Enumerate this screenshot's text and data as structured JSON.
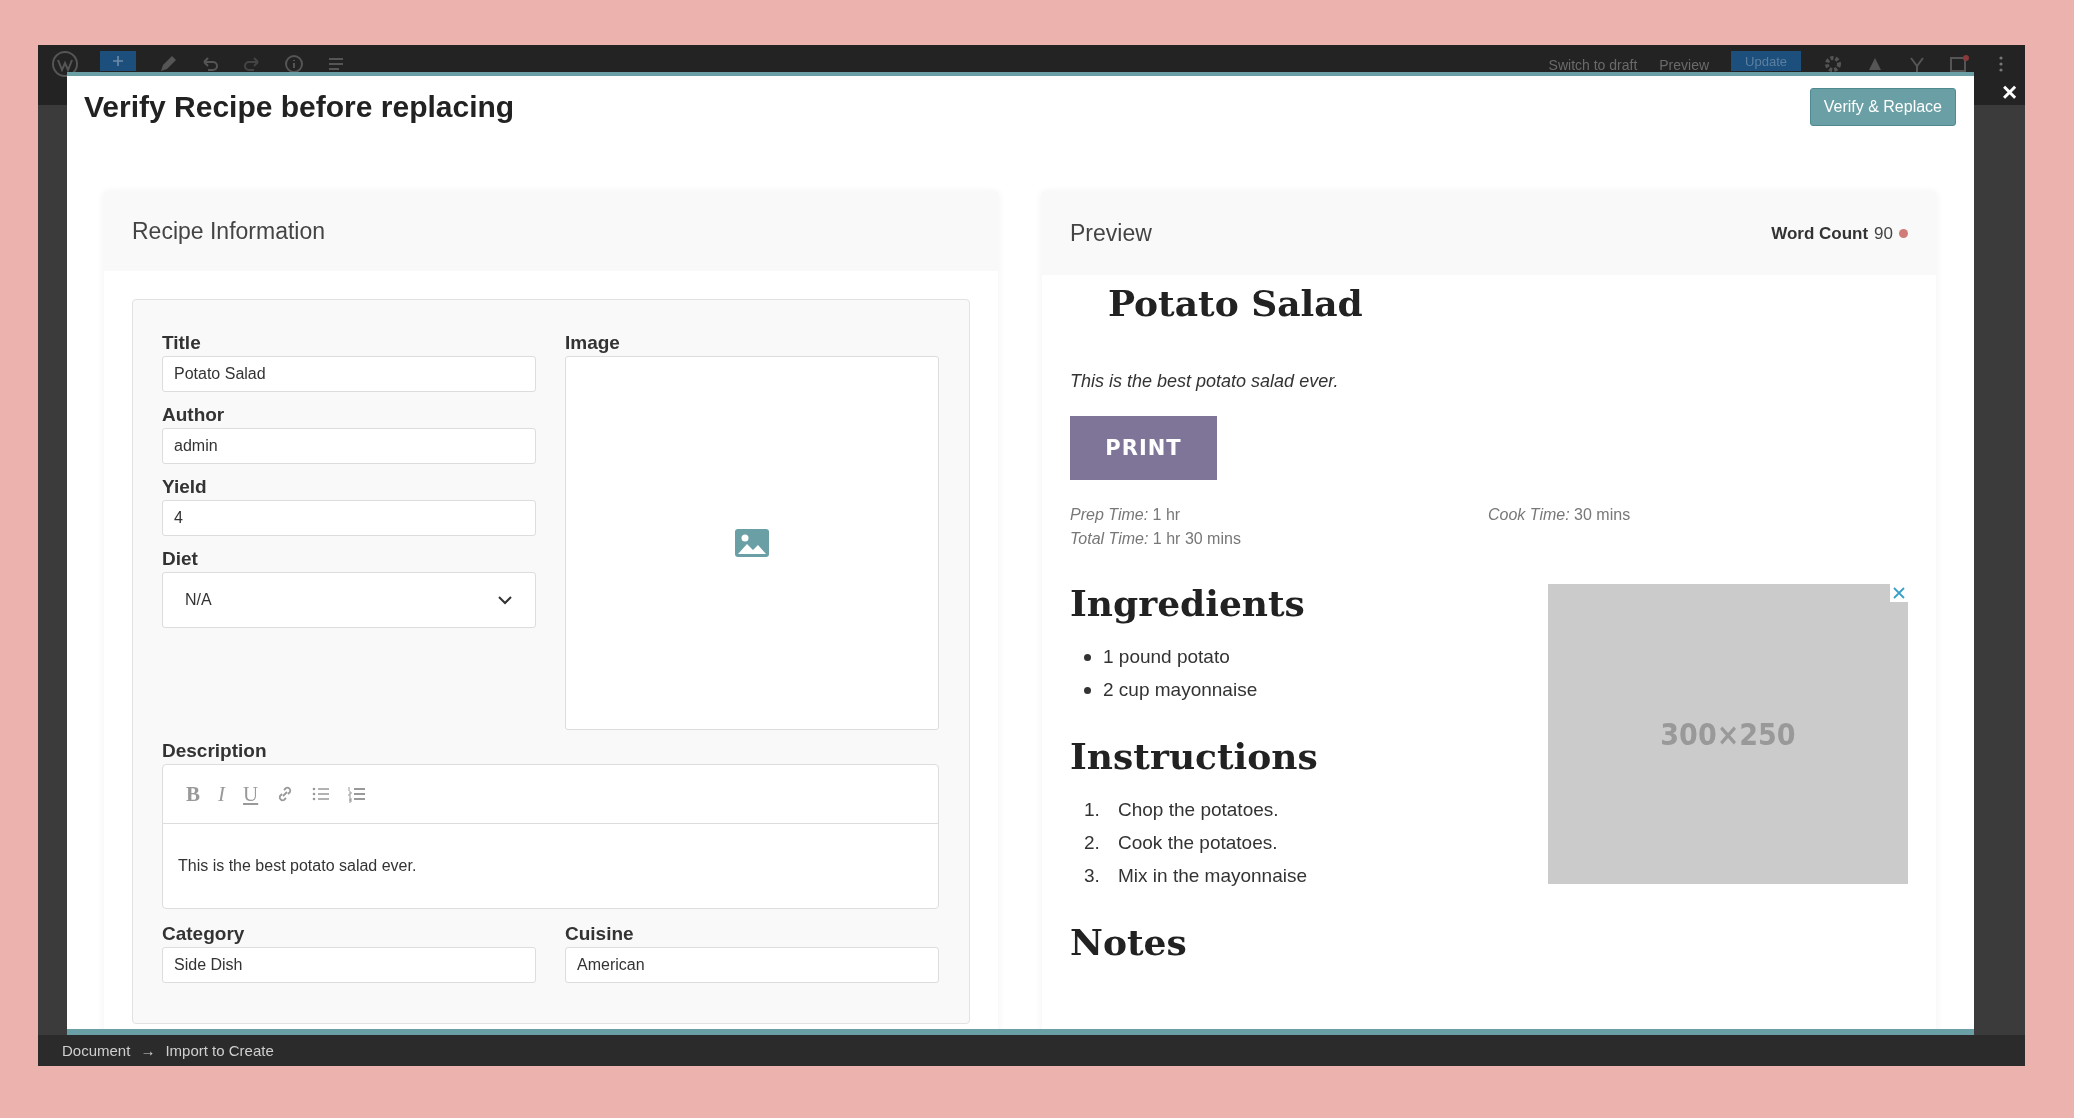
{
  "editor": {
    "toolbar_actions": [
      "Switch to draft",
      "Preview"
    ],
    "update_button": "Update",
    "breadcrumb": [
      "Document",
      "Import to Create"
    ],
    "breadcrumb_separator": "→"
  },
  "modal": {
    "title": "Verify Recipe before replacing",
    "verify_button": "Verify & Replace",
    "close": "×"
  },
  "recipe_panel": {
    "title": "Recipe Information",
    "fields": [
      {
        "label": "Title",
        "value": "Potato Salad"
      },
      {
        "label": "Author",
        "value": "admin"
      },
      {
        "label": "Yield",
        "value": "4"
      }
    ],
    "diet": {
      "label": "Diet",
      "value": "N/A"
    },
    "image": {
      "label": "Image"
    },
    "description": {
      "label": "Description",
      "format_buttons": [
        "B",
        "I",
        "U"
      ],
      "value": "This is the best potato salad ever."
    },
    "bottom_fields": [
      {
        "label": "Category",
        "value": "Side Dish"
      },
      {
        "label": "Cuisine",
        "value": "American"
      }
    ]
  },
  "preview_panel": {
    "title": "Preview",
    "word_count_label": "Word Count",
    "word_count": "90",
    "recipe": {
      "title": "Potato Salad",
      "summary": "This is the best potato salad ever.",
      "print_button": "PRINT",
      "times": [
        {
          "label": "Prep Time:",
          "value": "1 hr"
        },
        {
          "label": "Cook Time:",
          "value": "30 mins"
        },
        {
          "label": "Total Time:",
          "value": "1 hr 30 mins"
        }
      ],
      "sections": [
        {
          "heading": "Ingredients",
          "kind": "bullets",
          "items": [
            {
              "text": "1 pound potato"
            },
            {
              "text": "2 cup mayonnaise"
            }
          ]
        },
        {
          "heading": "Instructions",
          "kind": "numbered",
          "items": [
            {
              "number": "1.",
              "text": "Chop the potatoes."
            },
            {
              "number": "2.",
              "text": "Cook the potatoes."
            },
            {
              "number": "3.",
              "text": "Mix in the mayonnaise"
            }
          ]
        },
        {
          "heading": "Notes"
        }
      ]
    },
    "ad": {
      "text": "300×250"
    }
  }
}
